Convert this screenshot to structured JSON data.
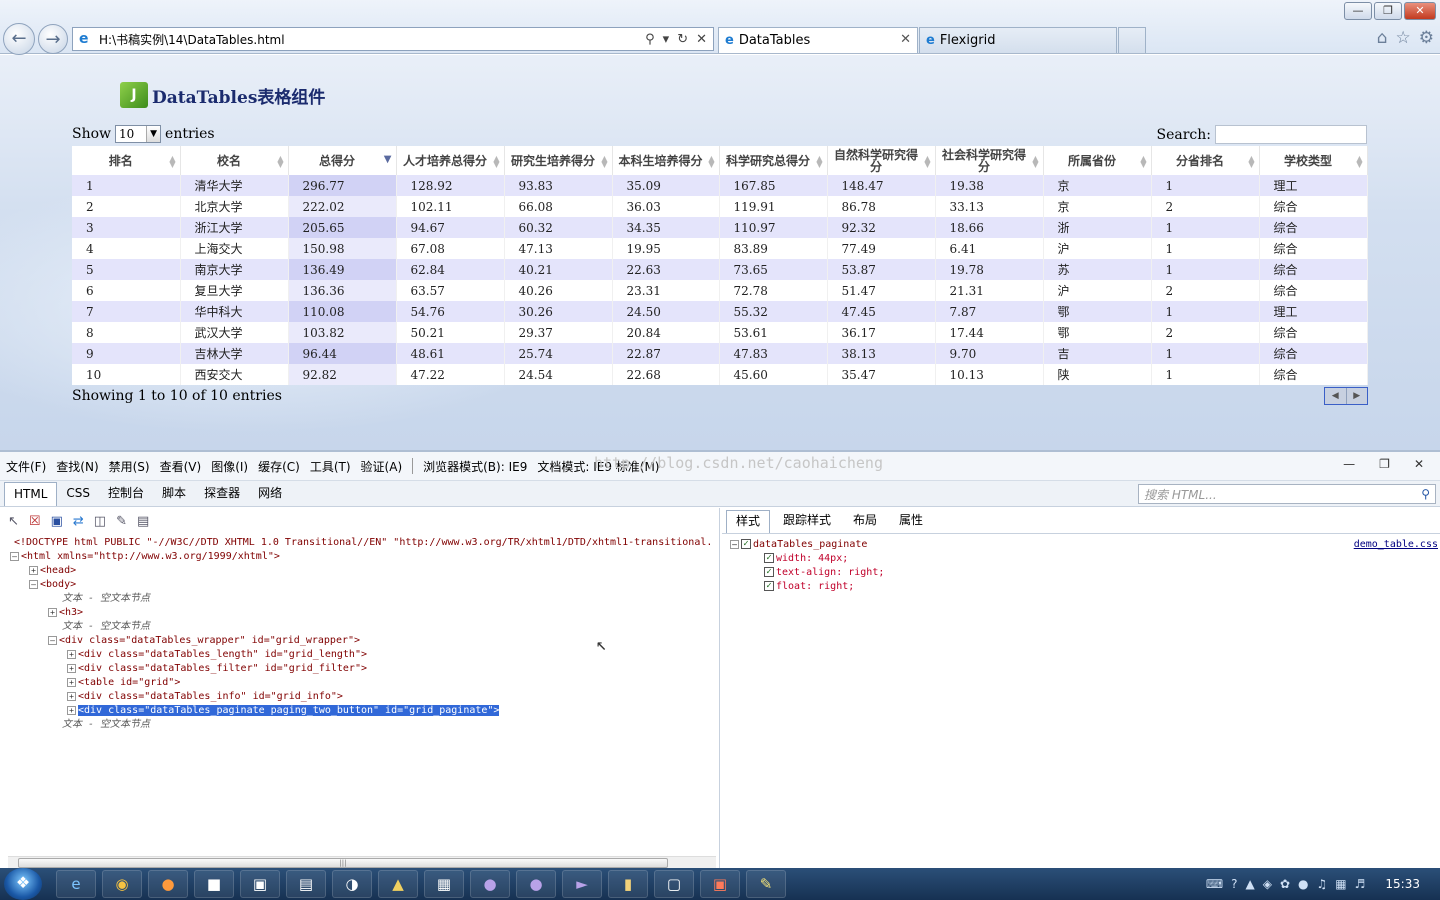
{
  "browser": {
    "address": "H:\\书稿实例\\14\\DataTables.html",
    "tabs": [
      {
        "label": "DataTables",
        "active": true
      },
      {
        "label": "Flexigrid",
        "active": false
      }
    ]
  },
  "page": {
    "title": "DataTables表格组件",
    "length_label_before": "Show",
    "length_value": "10",
    "length_label_after": "entries",
    "search_label": "Search:",
    "search_value": "",
    "info": "Showing 1 to 10 of 10 entries"
  },
  "table": {
    "headers": [
      "排名",
      "校名",
      "总得分",
      "人才培养总得分",
      "研究生培养得分",
      "本科生培养得分",
      "科学研究总得分",
      "自然科学研究得分",
      "社会科学研究得分",
      "所属省份",
      "分省排名",
      "学校类型"
    ],
    "sorted_column": 2,
    "rows": [
      [
        "1",
        "清华大学",
        "296.77",
        "128.92",
        "93.83",
        "35.09",
        "167.85",
        "148.47",
        "19.38",
        "京",
        "1",
        "理工"
      ],
      [
        "2",
        "北京大学",
        "222.02",
        "102.11",
        "66.08",
        "36.03",
        "119.91",
        "86.78",
        "33.13",
        "京",
        "2",
        "综合"
      ],
      [
        "3",
        "浙江大学",
        "205.65",
        "94.67",
        "60.32",
        "34.35",
        "110.97",
        "92.32",
        "18.66",
        "浙",
        "1",
        "综合"
      ],
      [
        "4",
        "上海交大",
        "150.98",
        "67.08",
        "47.13",
        "19.95",
        "83.89",
        "77.49",
        "6.41",
        "沪",
        "1",
        "综合"
      ],
      [
        "5",
        "南京大学",
        "136.49",
        "62.84",
        "40.21",
        "22.63",
        "73.65",
        "53.87",
        "19.78",
        "苏",
        "1",
        "综合"
      ],
      [
        "6",
        "复旦大学",
        "136.36",
        "63.57",
        "40.26",
        "23.31",
        "72.78",
        "51.47",
        "21.31",
        "沪",
        "2",
        "综合"
      ],
      [
        "7",
        "华中科大",
        "110.08",
        "54.76",
        "30.26",
        "24.50",
        "55.32",
        "47.45",
        "7.87",
        "鄂",
        "1",
        "理工"
      ],
      [
        "8",
        "武汉大学",
        "103.82",
        "50.21",
        "29.37",
        "20.84",
        "53.61",
        "36.17",
        "17.44",
        "鄂",
        "2",
        "综合"
      ],
      [
        "9",
        "吉林大学",
        "96.44",
        "48.61",
        "25.74",
        "22.87",
        "47.83",
        "38.13",
        "9.70",
        "吉",
        "1",
        "综合"
      ],
      [
        "10",
        "西安交大",
        "92.82",
        "47.22",
        "24.54",
        "22.68",
        "45.60",
        "35.47",
        "10.13",
        "陕",
        "1",
        "综合"
      ]
    ]
  },
  "devtools": {
    "menu": [
      "文件(F)",
      "查找(N)",
      "禁用(S)",
      "查看(V)",
      "图像(I)",
      "缓存(C)",
      "工具(T)",
      "验证(A)",
      "浏览器模式(B): IE9",
      "文档模式: IE9 标准(M)"
    ],
    "watermark": "http://blog.csdn.net/caohaicheng",
    "tabs": [
      "HTML",
      "CSS",
      "控制台",
      "脚本",
      "探查器",
      "网络"
    ],
    "search_placeholder": "搜索 HTML...",
    "code_lines": [
      "<!DOCTYPE html PUBLIC \"-//W3C//DTD XHTML 1.0 Transitional//EN\" \"http://www.w3.org/TR/xhtml1/DTD/xhtml1-transitional.",
      "<html xmlns=\"http://www.w3.org/1999/xhtml\">",
      "<head>",
      "<body>",
      "文本 - 空文本节点",
      "<h3>",
      "文本 - 空文本节点",
      "<div class=\"dataTables_wrapper\" id=\"grid_wrapper\">",
      "<div class=\"dataTables_length\" id=\"grid_length\">",
      "<div class=\"dataTables_filter\" id=\"grid_filter\">",
      "<table id=\"grid\">",
      "<div class=\"dataTables_info\" id=\"grid_info\">",
      "<div class=\"dataTables_paginate paging_two_button\" id=\"grid_paginate\">",
      "文本 - 空文本节点"
    ],
    "right_tabs": [
      "样式",
      "跟踪样式",
      "布局",
      "属性"
    ],
    "style_selector": "dataTables_paginate",
    "style_props": [
      "width: 44px;",
      "text-align: right;",
      "float: right;"
    ],
    "style_source": "demo_table.css"
  },
  "taskbar": {
    "clock": "15:33"
  }
}
